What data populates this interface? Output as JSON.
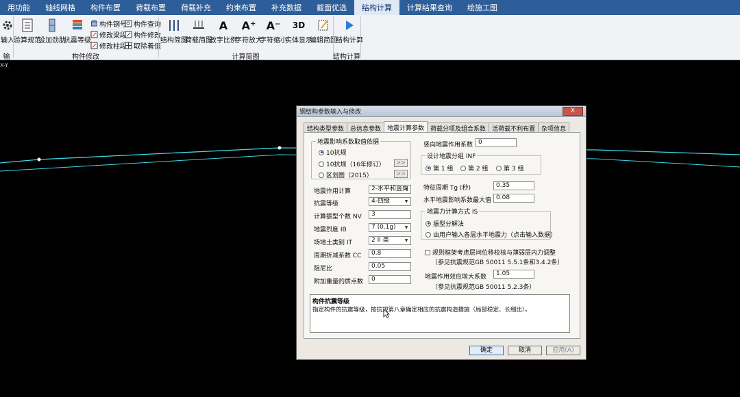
{
  "menubar": {
    "items": [
      {
        "label": "用功能"
      },
      {
        "label": "轴线网格"
      },
      {
        "label": "构件布置"
      },
      {
        "label": "荷载布置"
      },
      {
        "label": "荷载补充"
      },
      {
        "label": "约束布置"
      },
      {
        "label": "补充数据"
      },
      {
        "label": "截面优选"
      },
      {
        "label": "结构计算"
      },
      {
        "label": "计算结果查询"
      },
      {
        "label": "绘施工图"
      }
    ],
    "active_index": 8
  },
  "ribbon": {
    "input_label": "输入",
    "check_spec_label": "验算规范",
    "add_stiffener_label": "设加劲肋",
    "seismic_grade_label": "抗震等级",
    "member_steel_no_label": "构件钢号",
    "modify_beam_end_label": "修改梁段",
    "modify_column_end_label": "修改柱段",
    "member_query_label": "构件查询",
    "member_modify_label": "构件修改",
    "cancel_flagged_label": "取除着值",
    "struct_diagram_label": "结构简图",
    "load_diagram_label": "荷载简图",
    "text_scale_label": "改字比例",
    "font_enlarge_label": "字符放大",
    "font_shrink_label": "字符缩小",
    "solid_display_label": "实体显示",
    "edit_diagram_label": "编辑简图",
    "struct_calc_label": "结构计算",
    "group_input": "输入",
    "group_member_modify": "构件修改",
    "group_calc_diagram": "计算简图",
    "group_struct_calc": "结构计算"
  },
  "canvas": {
    "coord_readout": "X-Y"
  },
  "dialog": {
    "title": "钢结构参数输入与修改",
    "close": "X",
    "tabs": [
      {
        "label": "结构类型参数"
      },
      {
        "label": "总信息参数"
      },
      {
        "label": "地震计算参数"
      },
      {
        "label": "荷载分项及组合系数"
      },
      {
        "label": "活荷载不利布置"
      },
      {
        "label": "杂项信息"
      }
    ],
    "active_tab": 2,
    "basis_group": {
      "legend": "地震影响系数取值依据",
      "options": [
        {
          "label": "10抗规",
          "checked": true
        },
        {
          "label": "10抗规（16年修订）",
          "checked": false
        },
        {
          "label": "区划图（2015）",
          "checked": false
        }
      ],
      "more_btn": ">>"
    },
    "left_fields": [
      {
        "label": "地震作用计算",
        "value": "2-水平和竖向",
        "type": "select"
      },
      {
        "label": "抗震等级",
        "value": "4-四级",
        "type": "select"
      },
      {
        "label": "计算振型个数 NV",
        "value": "3",
        "type": "input"
      },
      {
        "label": "地震烈度 IB",
        "value": "7 (0.1g)",
        "type": "select"
      },
      {
        "label": "场地土类别 IT",
        "value": "2 II 类",
        "type": "select"
      },
      {
        "label": "周期折减系数 CC",
        "value": "0.8",
        "type": "input"
      },
      {
        "label": "阻尼比",
        "value": "0.05",
        "type": "input"
      },
      {
        "label": "附加重量的质点数",
        "value": "0",
        "type": "input"
      }
    ],
    "vertical_coef": {
      "label": "竖向地震作用系数",
      "value": "0"
    },
    "design_group": {
      "legend": "设计地震分组 INF",
      "options": [
        {
          "label": "第 1 组",
          "checked": true
        },
        {
          "label": "第 2 组",
          "checked": false
        },
        {
          "label": "第 3 组",
          "checked": false
        }
      ]
    },
    "period": {
      "label": "特征周期 Tg (秒)",
      "value": "0.35"
    },
    "max_coef": {
      "label": "水平地震影响系数最大值",
      "value": "0.08"
    },
    "method_group": {
      "legend": "地震力计算方式 IS",
      "options": [
        {
          "label": "振型分解法",
          "checked": true
        },
        {
          "label": "由用户输入各层水平地震力（点击输入数据）",
          "checked": false
        }
      ]
    },
    "regular_frame": {
      "label": "规则框架考虑层间位移校核与薄弱层内力调整",
      "note": "（参见抗震规范GB 50011 5.5.1条和3.4.2条）",
      "checked": false
    },
    "effect_factor": {
      "label": "地震作用效应增大系数",
      "value": "1.05",
      "note": "（参见抗震规范GB 50011 5.2.3条）"
    },
    "help": {
      "title": "构件抗震等级",
      "text": "指定构件的抗震等级，按抗规第八章确定相应的抗震构造措施（局部稳定、长细比）。"
    },
    "buttons": {
      "ok": "确定",
      "cancel": "取消",
      "apply": "应用(A)"
    }
  },
  "colors": {
    "menubar": "#2e5e99",
    "canvas": "#000000",
    "model_line": "#3fd6e6"
  }
}
